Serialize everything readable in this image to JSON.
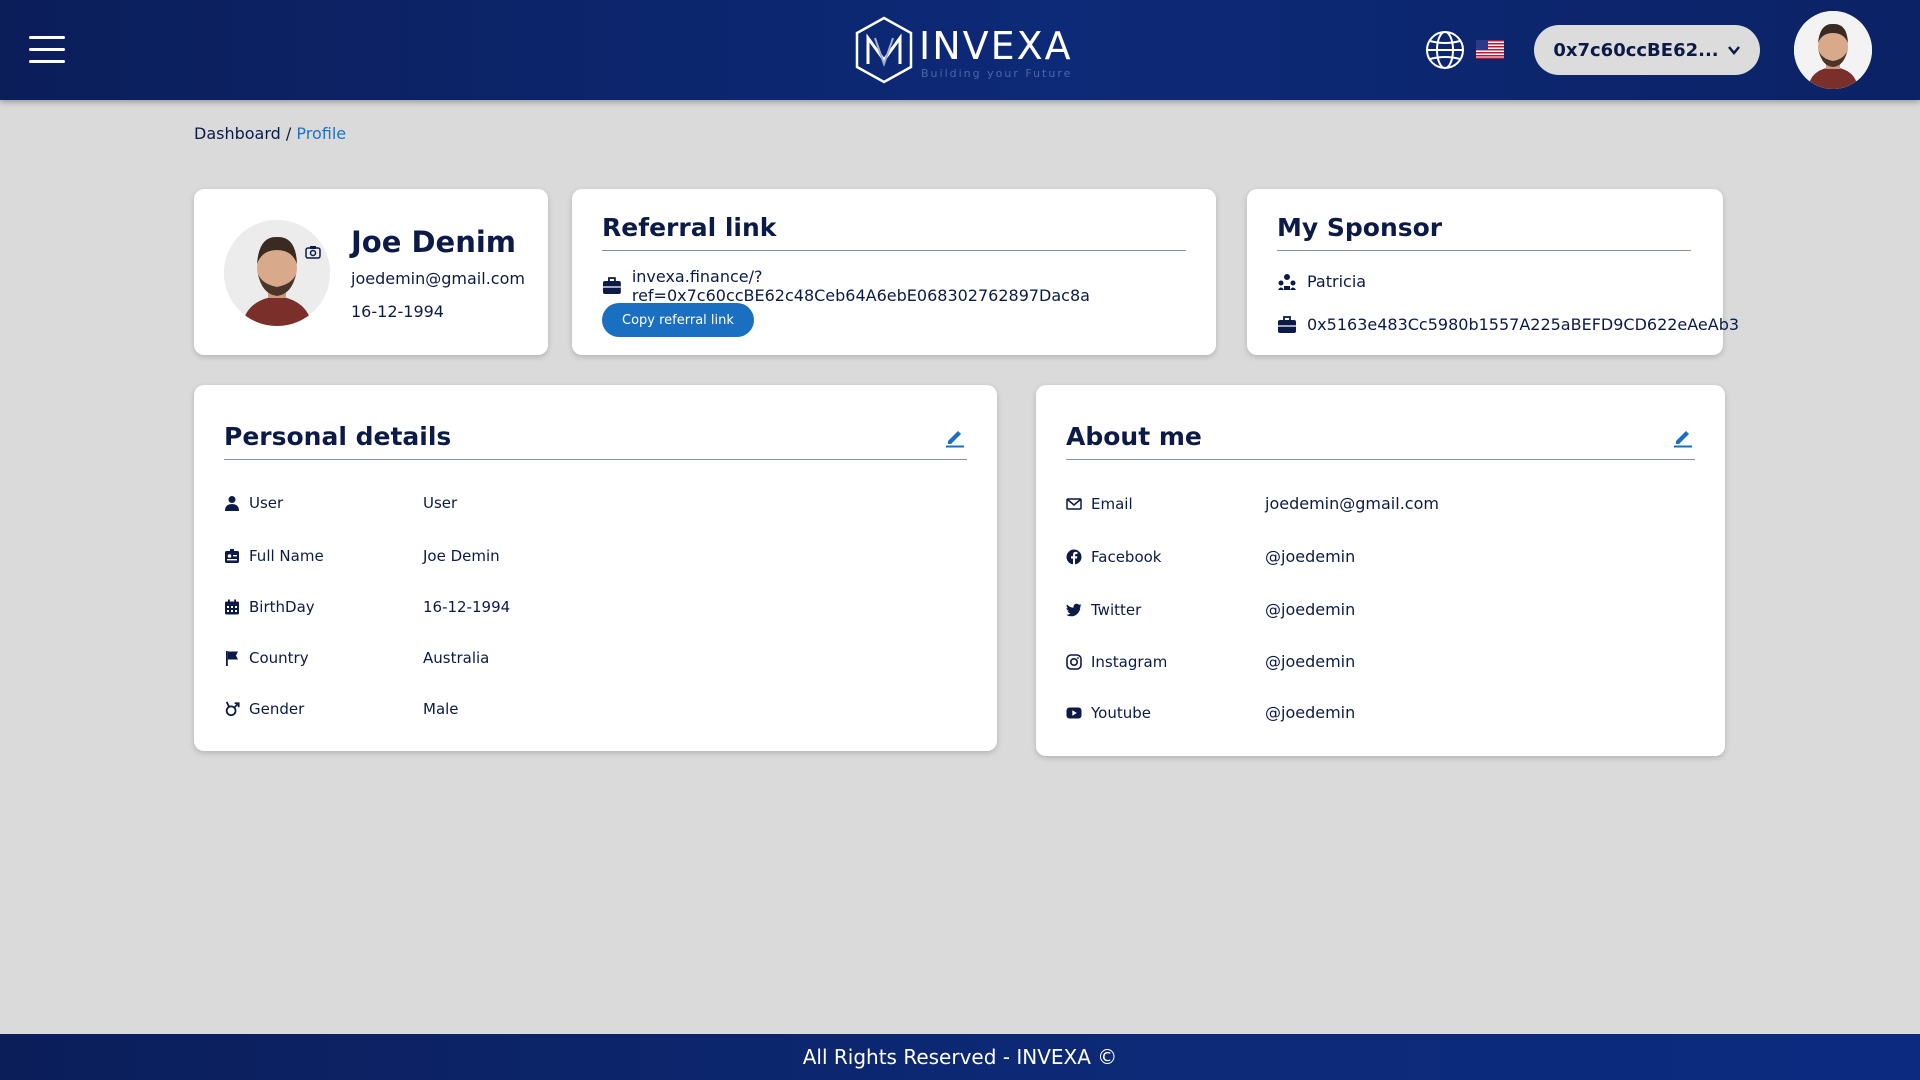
{
  "header": {
    "brand": "INVEXA",
    "tagline": "Building your Future",
    "wallet": "0x7c60ccBE62..."
  },
  "breadcrumb": {
    "parent": "Dashboard",
    "separator": "/",
    "current": "Profile"
  },
  "profile": {
    "name": "Joe Denim",
    "email": "joedemin@gmail.com",
    "dob": "16-12-1994"
  },
  "referral": {
    "title": "Referral link",
    "link": "invexa.finance/?ref=0x7c60ccBE62c48Ceb64A6ebE068302762897Dac8a",
    "copy_label": "Copy referral link"
  },
  "sponsor": {
    "title": "My Sponsor",
    "name": "Patricia",
    "address": "0x5163e483Cc5980b1557A225aBEFD9CD622eAeAb3"
  },
  "personal": {
    "title": "Personal details",
    "rows": [
      {
        "icon": "user-icon",
        "label": "User",
        "value": "User"
      },
      {
        "icon": "id-card-icon",
        "label": "Full Name",
        "value": "Joe Demin"
      },
      {
        "icon": "calendar-icon",
        "label": "BirthDay",
        "value": "16-12-1994"
      },
      {
        "icon": "flag-icon",
        "label": "Country",
        "value": "Australia"
      },
      {
        "icon": "gender-icon",
        "label": "Gender",
        "value": "Male"
      }
    ]
  },
  "about": {
    "title": "About me",
    "rows": [
      {
        "icon": "mail-icon",
        "label": "Email",
        "value": "joedemin@gmail.com"
      },
      {
        "icon": "facebook-icon",
        "label": "Facebook",
        "value": "@joedemin"
      },
      {
        "icon": "twitter-icon",
        "label": "Twitter",
        "value": "@joedemin"
      },
      {
        "icon": "instagram-icon",
        "label": "Instagram",
        "value": "@joedemin"
      },
      {
        "icon": "youtube-icon",
        "label": "Youtube",
        "value": "@joedemin"
      }
    ]
  },
  "footer": {
    "text": "All Rights Reserved - INVEXA ©"
  },
  "colors": {
    "navy": "#0c1a47",
    "header": "#0d2a78",
    "accent": "#1a6fc0",
    "background": "#dadada"
  }
}
